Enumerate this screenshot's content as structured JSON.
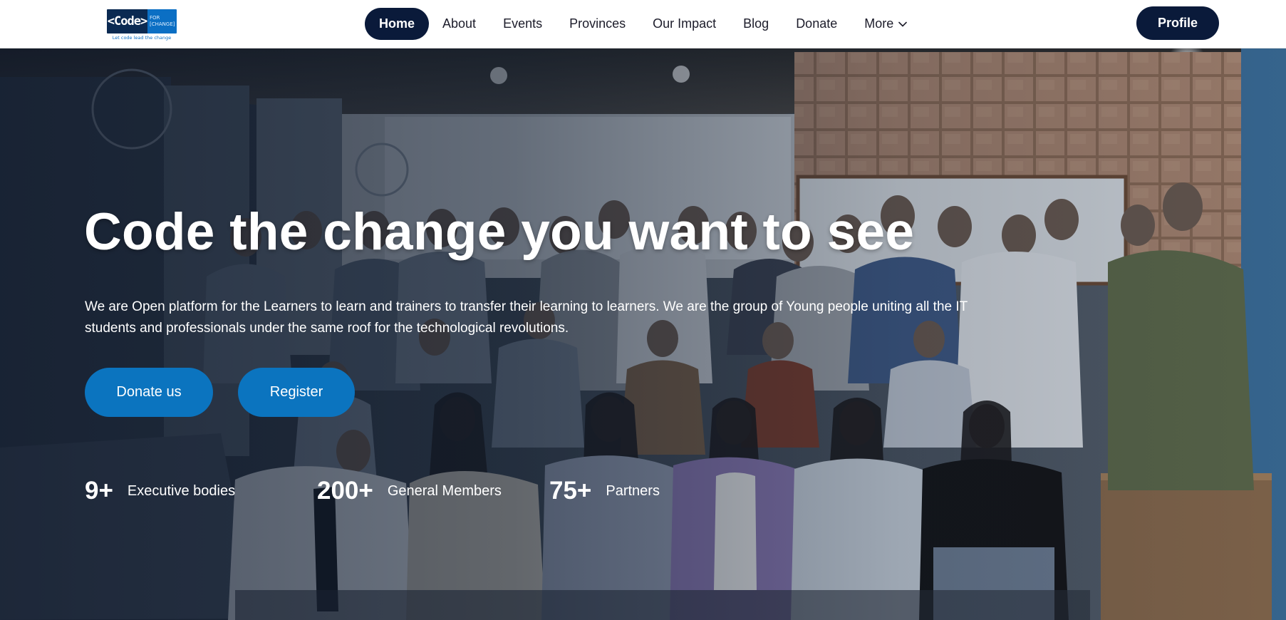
{
  "header": {
    "logo": {
      "code_text": "<Code>",
      "for_text": "FOR",
      "change_text": "[CHANGE]",
      "tagline": "Let code lead the change"
    },
    "nav": [
      {
        "label": "Home",
        "active": true
      },
      {
        "label": "About"
      },
      {
        "label": "Events"
      },
      {
        "label": "Provinces"
      },
      {
        "label": "Our Impact"
      },
      {
        "label": "Blog"
      },
      {
        "label": "Donate"
      },
      {
        "label": "More",
        "icon": "chevron-down-icon"
      }
    ],
    "profile_label": "Profile"
  },
  "hero": {
    "title": "Code the change you want to see",
    "description": "We are Open platform for the Learners to learn and trainers to transfer their learning to learners. We are the group of Young people uniting all the IT students and professionals under the same roof for the technological revolutions.",
    "buttons": {
      "donate": "Donate us",
      "register": "Register"
    },
    "stats": [
      {
        "value": "9+",
        "label": "Executive bodies"
      },
      {
        "value": "200+",
        "label": "General Members"
      },
      {
        "value": "75+",
        "label": "Partners"
      }
    ]
  },
  "colors": {
    "navy": "#0a1a3a",
    "accent_blue": "#0b74bf",
    "logo_blue": "#0b6fc4",
    "white": "#ffffff"
  }
}
